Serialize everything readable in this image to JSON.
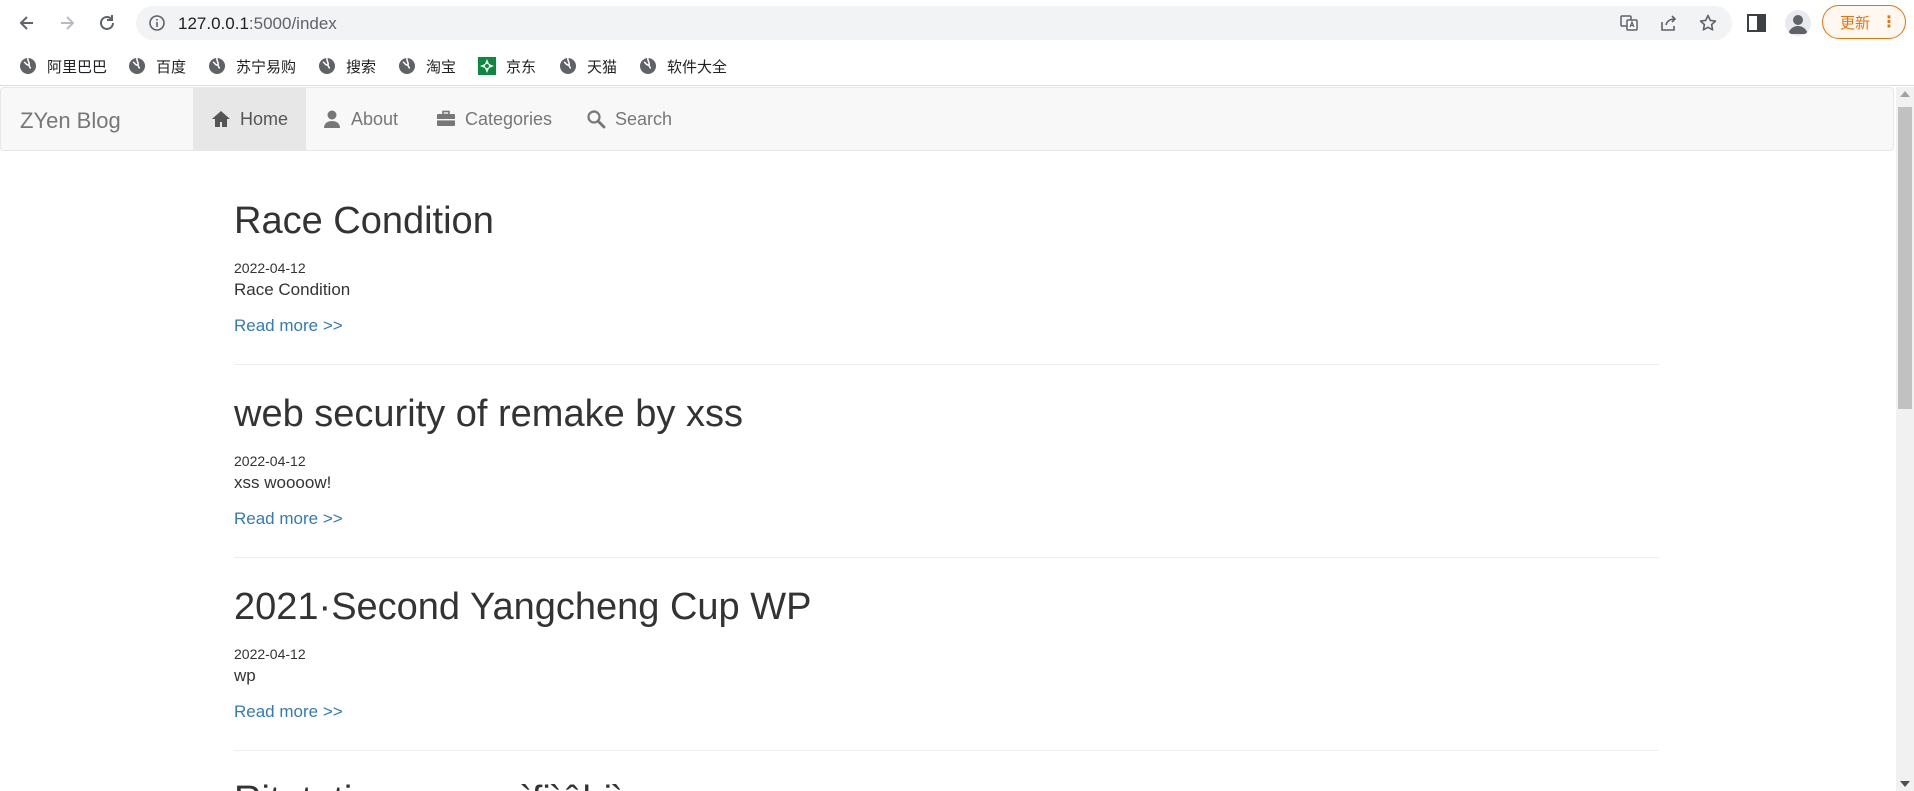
{
  "browser": {
    "url_host": "127.0.0.1",
    "url_path": ":5000/index",
    "update_label": "更新",
    "more_dots": "⋮"
  },
  "bookmarks": [
    {
      "label": "阿里巴巴",
      "icon": "globe-icon"
    },
    {
      "label": "百度",
      "icon": "globe-icon"
    },
    {
      "label": "苏宁易购",
      "icon": "globe-icon"
    },
    {
      "label": "搜索",
      "icon": "globe-icon"
    },
    {
      "label": "淘宝",
      "icon": "globe-icon"
    },
    {
      "label": "京东",
      "icon": "jd-icon"
    },
    {
      "label": "天猫",
      "icon": "globe-icon"
    },
    {
      "label": "软件大全",
      "icon": "globe-icon"
    }
  ],
  "navbar": {
    "brand": "ZYen Blog",
    "items": [
      {
        "label": "Home",
        "icon": "home-icon",
        "active": true
      },
      {
        "label": "About",
        "icon": "user-icon",
        "active": false
      },
      {
        "label": "Categories",
        "icon": "briefcase-icon",
        "active": false
      },
      {
        "label": "Search",
        "icon": "search-icon",
        "active": false
      }
    ]
  },
  "posts": [
    {
      "title": "Race Condition",
      "date": "2022-04-12",
      "summary": "Race Condition",
      "more": "Read more >>"
    },
    {
      "title": "web security of remake by xss",
      "date": "2022-04-12",
      "summary": "xss woooow!",
      "more": "Read more >>"
    },
    {
      "title": "2021·Second Yangcheng Cup WP",
      "date": "2022-04-12",
      "summary": "wp",
      "more": "Read more >>"
    },
    {
      "title": "Ritotatimoo..ww..ìfiìêbiìe",
      "date": "",
      "summary": "",
      "more": ""
    }
  ],
  "colors": {
    "link": "#337ab7",
    "navbar_bg": "#f8f8f8",
    "active_bg": "#e7e7e7",
    "update_accent": "#e8710a"
  }
}
